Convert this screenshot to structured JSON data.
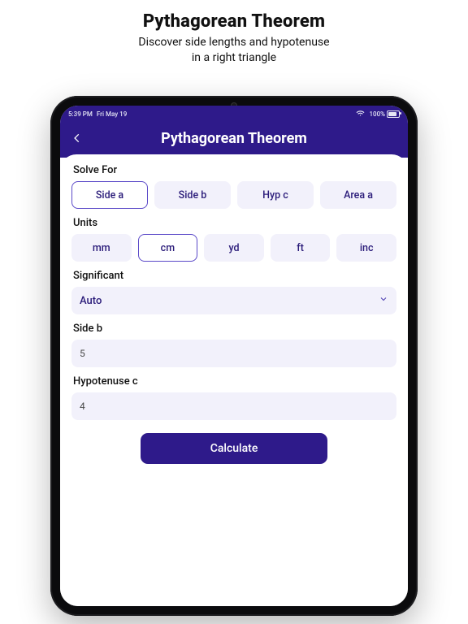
{
  "promo": {
    "title": "Pythagorean Theorem",
    "subtitle_line1": "Discover side lengths and hypotenuse",
    "subtitle_line2": "in a right triangle"
  },
  "status": {
    "time": "5:39 PM",
    "date": "Fri May 19",
    "battery_pct": "100%"
  },
  "header": {
    "title": "Pythagorean Theorem"
  },
  "solve_for": {
    "label": "Solve For",
    "options": [
      "Side a",
      "Side b",
      "Hyp c",
      "Area a"
    ],
    "selected_index": 0
  },
  "units": {
    "label": "Units",
    "options": [
      "mm",
      "cm",
      "yd",
      "ft",
      "inc"
    ],
    "selected_index": 1
  },
  "significant": {
    "label": "Significant",
    "value": "Auto"
  },
  "inputs": {
    "side_b": {
      "label": "Side b",
      "value": "5"
    },
    "hyp_c": {
      "label": "Hypotenuse c",
      "value": "4"
    }
  },
  "actions": {
    "calculate": "Calculate"
  }
}
